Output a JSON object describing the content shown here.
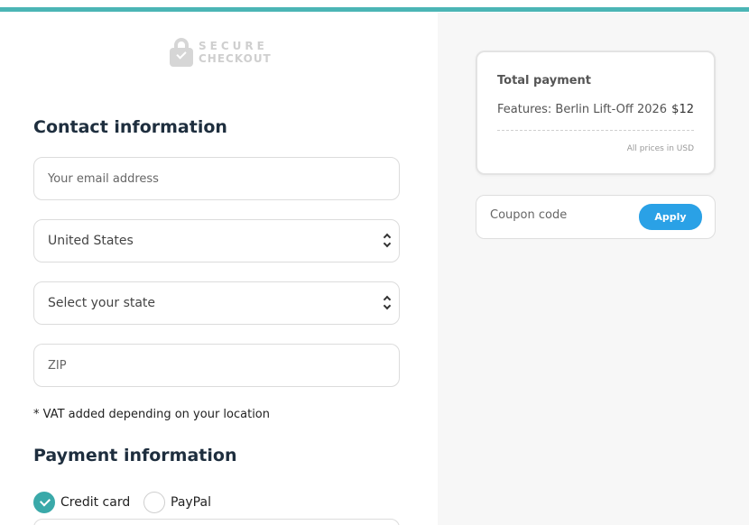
{
  "brand": {
    "secure_line1": "SECURE",
    "secure_line2": "CHECKOUT",
    "accent_color": "#4bb5b5"
  },
  "contact": {
    "heading": "Contact information",
    "email_placeholder": "Your email address",
    "country_value": "United States",
    "state_value": "Select your state",
    "zip_placeholder": "ZIP",
    "vat_note": "* VAT added depending on your location"
  },
  "payment": {
    "heading": "Payment information",
    "options": [
      {
        "label": "Credit card",
        "selected": true
      },
      {
        "label": "PayPal",
        "selected": false
      }
    ]
  },
  "summary": {
    "title": "Total payment",
    "item_label": "Features: Berlin Lift-Off 2026",
    "item_price": "$12",
    "currency_note": "All prices in USD"
  },
  "coupon": {
    "placeholder": "Coupon code",
    "apply_label": "Apply",
    "button_color": "#2aa1e6"
  }
}
